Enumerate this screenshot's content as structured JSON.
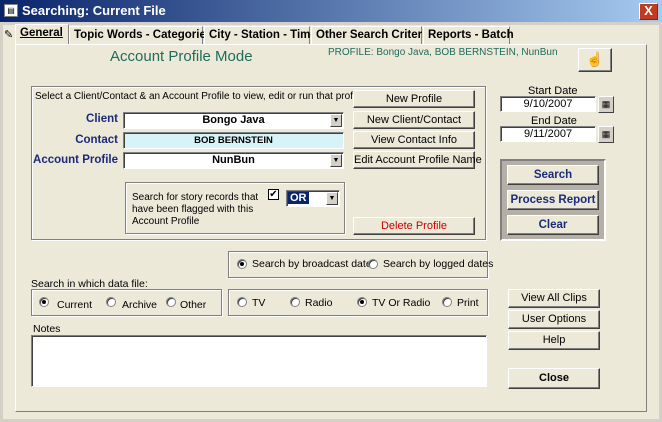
{
  "window": {
    "title": "Searching: Current File",
    "close_glyph": "X",
    "icon": "form-icon"
  },
  "tabs": [
    {
      "label": "General"
    },
    {
      "label": "Topic Words - Categories"
    },
    {
      "label": "City - Station - Time"
    },
    {
      "label": "Other Search Criteria"
    },
    {
      "label": "Reports - Batch"
    }
  ],
  "header": {
    "mode": "Account Profile Mode",
    "profile": "PROFILE:  Bongo Java, BOB BERNSTEIN, NunBun"
  },
  "profile_section": {
    "instructions": "Select a Client/Contact & an Account Profile to view, edit or run that profile",
    "client_label": "Client",
    "client_value": "Bongo Java",
    "contact_label": "Contact",
    "contact_value": "BOB BERNSTEIN",
    "account_profile_label": "Account Profile",
    "account_profile_value": "NunBun",
    "flag_text": "Search for story records that have been flagged with this Account Profile",
    "flag_checked": "✔",
    "flag_operator": "OR"
  },
  "profile_buttons": {
    "new_profile": "New Profile",
    "new_client_contact": "New Client/Contact",
    "view_contact_info": "View Contact Info",
    "edit_account_profile_name": "Edit Account Profile Name",
    "delete_profile": "Delete Profile"
  },
  "dates": {
    "start_label": "Start Date",
    "start_value": "9/10/2007",
    "end_label": "End Date",
    "end_value": "9/11/2007"
  },
  "actions": {
    "search": "Search",
    "process_report": "Process Report",
    "clear": "Clear"
  },
  "date_mode": {
    "broadcast": "Search by broadcast dates",
    "logged": "Search by logged dates",
    "selected": "broadcast"
  },
  "data_file": {
    "label": "Search in which data file:",
    "options": [
      "Current",
      "Archive",
      "Other"
    ],
    "selected": "Current"
  },
  "media": {
    "options": [
      "TV",
      "Radio",
      "TV Or Radio",
      "Print"
    ],
    "selected": "TV Or Radio"
  },
  "notes": {
    "label": "Notes",
    "value": ""
  },
  "side_buttons": {
    "view_all_clips": "View All Clips",
    "user_options": "User Options",
    "help": "Help",
    "close": "Close"
  },
  "colors": {
    "titlebar": "#0a246a",
    "accent_text": "#1b2a7a",
    "heading": "#1f6b5c",
    "delete": "#cc0000"
  }
}
